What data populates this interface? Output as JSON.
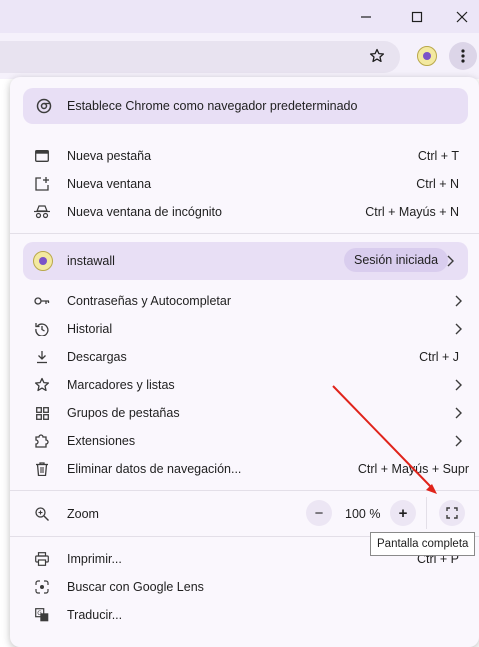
{
  "window": {
    "minimize_icon": "minimize-icon",
    "maximize_icon": "maximize-icon",
    "close_icon": "close-icon"
  },
  "toolbar": {
    "bookmark_icon": "star-icon",
    "profile_icon": "avatar-icon",
    "menu_icon": "kebab-menu-icon"
  },
  "menu": {
    "default_browser": {
      "label": "Establece Chrome como navegador predeterminado",
      "icon": "chrome-icon"
    },
    "tabs": [
      {
        "label": "Nueva pestaña",
        "shortcut": "Ctrl + T",
        "icon": "new-tab-icon"
      },
      {
        "label": "Nueva ventana",
        "shortcut": "Ctrl + N",
        "icon": "new-window-icon"
      },
      {
        "label": "Nueva ventana de incógnito",
        "shortcut": "Ctrl + Mayús + N",
        "icon": "incognito-icon"
      }
    ],
    "profile": {
      "name": "instawall",
      "status": "Sesión iniciada"
    },
    "items": [
      {
        "label": "Contraseñas y Autocompletar",
        "shortcut": "",
        "icon": "key-icon",
        "submenu": true
      },
      {
        "label": "Historial",
        "shortcut": "",
        "icon": "history-icon",
        "submenu": true
      },
      {
        "label": "Descargas",
        "shortcut": "Ctrl + J",
        "icon": "download-icon",
        "submenu": false
      },
      {
        "label": "Marcadores y listas",
        "shortcut": "",
        "icon": "star-icon",
        "submenu": true
      },
      {
        "label": "Grupos de pestañas",
        "shortcut": "",
        "icon": "tab-groups-icon",
        "submenu": true
      },
      {
        "label": "Extensiones",
        "shortcut": "",
        "icon": "puzzle-icon",
        "submenu": true
      },
      {
        "label": "Eliminar datos de navegación...",
        "shortcut": "Ctrl + Mayús + Supr",
        "icon": "trash-icon",
        "submenu": false
      }
    ],
    "zoom": {
      "label": "Zoom",
      "value": "100 %",
      "minus": "−",
      "plus": "+"
    },
    "bottom": [
      {
        "label": "Imprimir...",
        "shortcut": "Ctrl + P",
        "icon": "print-icon"
      },
      {
        "label": "Buscar con Google Lens",
        "shortcut": "",
        "icon": "lens-icon"
      },
      {
        "label": "Traducir...",
        "shortcut": "",
        "icon": "translate-icon"
      }
    ]
  },
  "tooltip": {
    "text": "Pantalla completa"
  },
  "colors": {
    "accent": "#e8dff5",
    "arrow": "#e0241b"
  }
}
